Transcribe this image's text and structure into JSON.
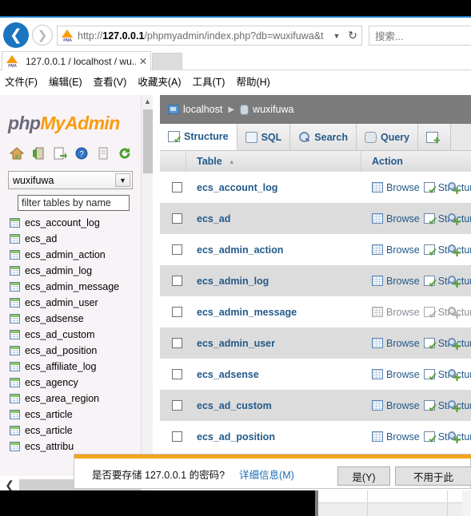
{
  "browser": {
    "back_icon": "back-arrow-icon",
    "forward_icon": "forward-arrow-icon",
    "url": {
      "scheme": "http://",
      "host": "127.0.0.1",
      "path": "/phpmyadmin/index.php?db=wuxifuwa&t",
      "full": "http://127.0.0.1/phpmyadmin/index.php?db=wuxifuwa&t",
      "dropdown_icon": "chevron-down-icon",
      "reload_icon": "reload-icon",
      "favicon": "pma-favicon"
    },
    "search": {
      "placeholder": "搜索..."
    },
    "tab": {
      "title": "127.0.0.1 / localhost / wu...",
      "close_icon": "close-icon",
      "favicon": "pma-favicon"
    },
    "menu": [
      {
        "label": "文件(F)"
      },
      {
        "label": "编辑(E)"
      },
      {
        "label": "查看(V)"
      },
      {
        "label": "收藏夹(A)"
      },
      {
        "label": "工具(T)"
      },
      {
        "label": "帮助(H)"
      }
    ]
  },
  "navi": {
    "logo": {
      "part1": "php",
      "part2": "MyAdmin"
    },
    "icons": [
      {
        "name": "home-icon"
      },
      {
        "name": "logout-icon"
      },
      {
        "name": "sql-window-icon"
      },
      {
        "name": "help-icon"
      },
      {
        "name": "docs-icon"
      },
      {
        "name": "reload-navigation-icon"
      }
    ],
    "database_select": {
      "value": "wuxifuwa",
      "arrow_icon": "chevron-down-icon"
    },
    "filter": {
      "value": "filter tables by name",
      "placeholder": "filter tables by name"
    },
    "tables": [
      {
        "name": "ecs_account_log"
      },
      {
        "name": "ecs_ad"
      },
      {
        "name": "ecs_admin_action"
      },
      {
        "name": "ecs_admin_log"
      },
      {
        "name": "ecs_admin_message"
      },
      {
        "name": "ecs_admin_user"
      },
      {
        "name": "ecs_adsense"
      },
      {
        "name": "ecs_ad_custom"
      },
      {
        "name": "ecs_ad_position"
      },
      {
        "name": "ecs_affiliate_log"
      },
      {
        "name": "ecs_agency"
      },
      {
        "name": "ecs_area_region"
      },
      {
        "name": "ecs_article"
      },
      {
        "name": "ecs_article"
      },
      {
        "name": "ecs_attribu"
      }
    ],
    "scroll_up_icon": "chevron-up-icon",
    "scroll_left_icon": "chevron-left-icon"
  },
  "main": {
    "breadcrumb": {
      "server": "localhost",
      "database": "wuxifuwa",
      "separator": "▶"
    },
    "tabs": [
      {
        "label": "Structure",
        "icon": "structure-icon",
        "active": true
      },
      {
        "label": "SQL",
        "icon": "sql-icon",
        "active": false
      },
      {
        "label": "Search",
        "icon": "search-icon",
        "active": false
      },
      {
        "label": "Query",
        "icon": "query-icon",
        "active": false
      },
      {
        "label": "",
        "icon": "export-icon",
        "active": false
      }
    ],
    "table_headers": {
      "check": "",
      "table": "Table",
      "sort_mark": "▲",
      "action": "Action"
    },
    "action_labels": {
      "browse": "Browse",
      "structure": "Structure",
      "search_icon": "search-table-icon"
    },
    "rows": [
      {
        "name": "ecs_account_log",
        "empty": false
      },
      {
        "name": "ecs_ad",
        "empty": false
      },
      {
        "name": "ecs_admin_action",
        "empty": false
      },
      {
        "name": "ecs_admin_log",
        "empty": false
      },
      {
        "name": "ecs_admin_message",
        "empty": true
      },
      {
        "name": "ecs_admin_user",
        "empty": false
      },
      {
        "name": "ecs_adsense",
        "empty": false
      },
      {
        "name": "ecs_ad_custom",
        "empty": false
      },
      {
        "name": "ecs_ad_position",
        "empty": false
      }
    ]
  },
  "notification": {
    "message": "是否要存储 127.0.0.1 的密码?",
    "details_link": "详细信息(M)",
    "buttons": [
      {
        "label": "是(Y)",
        "wide": false
      },
      {
        "label": "不用于此",
        "wide": true
      }
    ]
  },
  "colors": {
    "accent_blue": "#1b74c0",
    "pma_orange": "#f89c0e",
    "link_blue": "#235a8a",
    "notify_orange": "#f2a41a",
    "breadcrumb_gray": "#7b7b7b"
  }
}
